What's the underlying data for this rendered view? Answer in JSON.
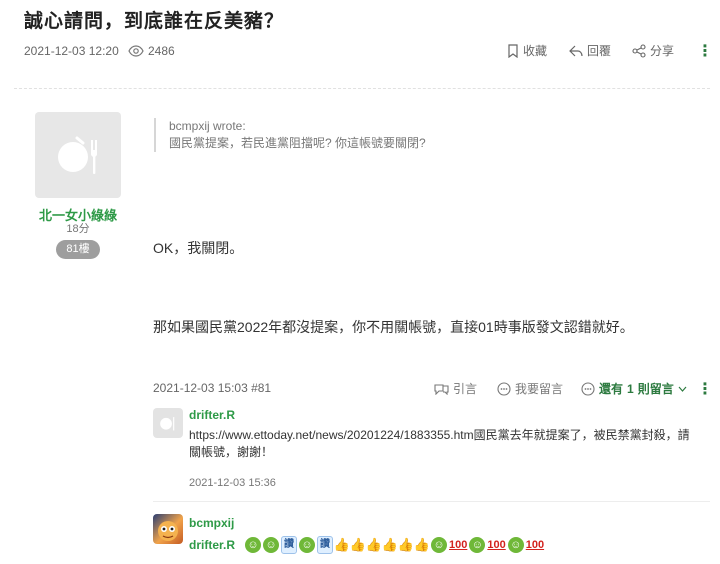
{
  "post": {
    "title": "誠心請問，到底誰在反美豬？",
    "date": "2021-12-03 12:20",
    "views": "2486",
    "actions": {
      "collect": "收藏",
      "reply": "回覆",
      "share": "分享"
    }
  },
  "reply_post": {
    "author": "北一女小綠綠",
    "score": "18分",
    "floor": "81樓",
    "quote": {
      "author_line": "bcmpxij wrote:",
      "text": "國民黨提案，若民進黨阻擋呢? 你這帳號要關閉?"
    },
    "paragraphs": [
      "OK，我關閉。",
      "那如果國民黨2022年都沒提案，你不用關帳號，直接01時事版發文認錯就好。"
    ],
    "meta": "2021-12-03 15:03 #81",
    "actions": {
      "quote": "引言",
      "comment": "我要留言",
      "replies_prefix": "還有",
      "replies_count": "1",
      "replies_suffix": "則留言"
    }
  },
  "comments": [
    {
      "author": "drifter.R",
      "text": "https://www.ettoday.net/news/20201224/1883355.htm國民黨去年就提案了，被民禁黨封殺，請關帳號，謝謝！",
      "date": "2021-12-03 15:36"
    },
    {
      "author": "bcmpxij",
      "mention": "drifter.R",
      "reaction_text": {
        "read": "讚",
        "hundred": "100"
      }
    }
  ],
  "colors": {
    "accent_green": "#2e9a47",
    "badge_gray": "#9e9e9e"
  },
  "icons": [
    "eye-icon",
    "bookmark-icon",
    "reply-icon",
    "share-icon",
    "kebab-icon",
    "quote-icon",
    "comment-icon",
    "chevron-down-icon"
  ]
}
